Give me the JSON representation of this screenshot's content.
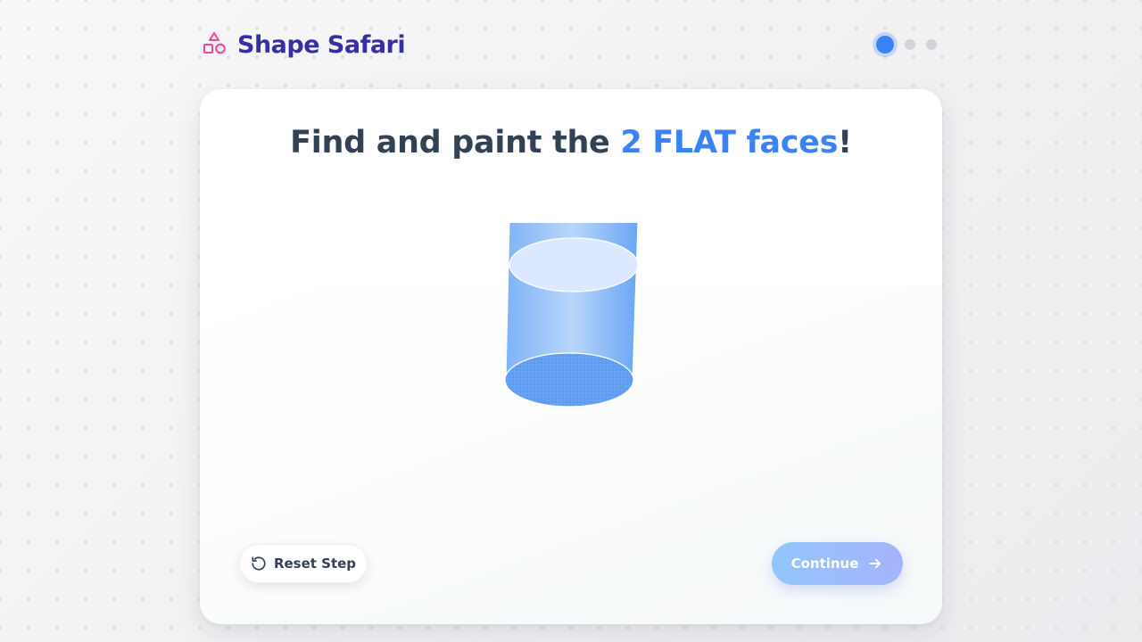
{
  "app": {
    "name": "Shape Safari",
    "logo_icon": "shapes-icon",
    "brand_color": "#3730a3",
    "logo_accent": "#ec4899"
  },
  "progress": {
    "total_steps": 3,
    "current_step": 1
  },
  "task": {
    "prompt_prefix": "Find and paint the ",
    "prompt_highlight": "2 FLAT faces",
    "prompt_suffix": "!",
    "highlight_color": "#3b82f6"
  },
  "shape": {
    "name": "cylinder",
    "faces": [
      {
        "id": "top",
        "type": "flat",
        "painted": false
      },
      {
        "id": "side",
        "type": "curved",
        "painted": false
      },
      {
        "id": "bottom",
        "type": "flat",
        "painted": false
      }
    ]
  },
  "actions": {
    "reset_label": "Reset Step",
    "reset_icon": "rotate-ccw-icon",
    "continue_label": "Continue",
    "continue_icon": "arrow-right-icon",
    "continue_enabled": false
  }
}
